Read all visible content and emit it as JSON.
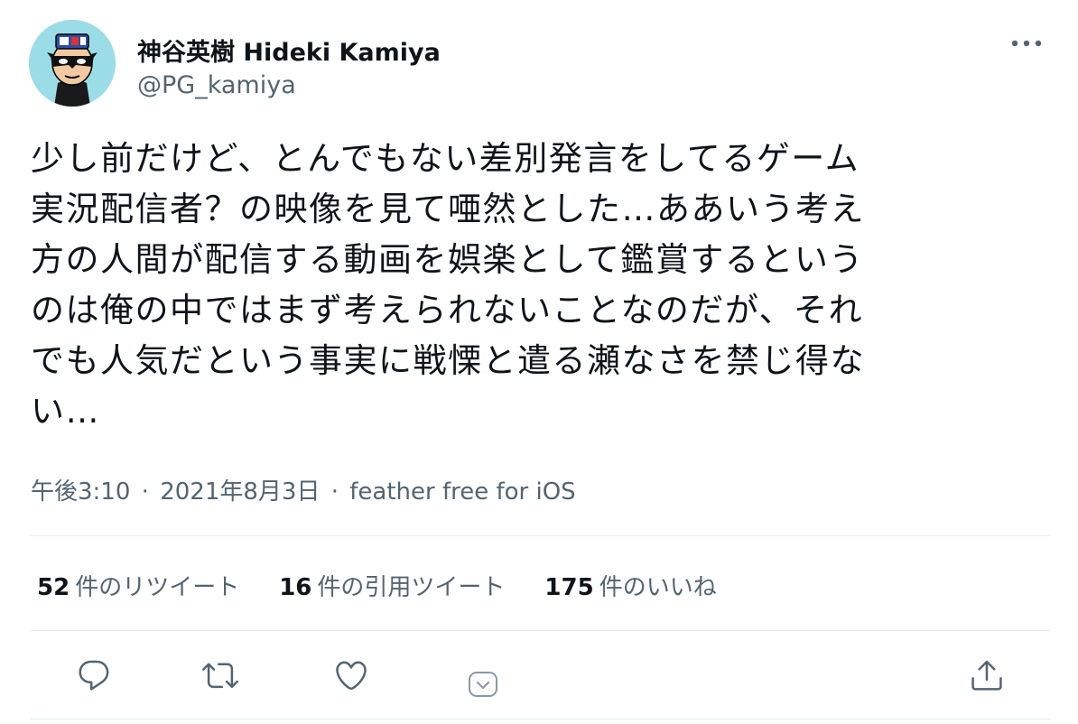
{
  "user": {
    "display_name": "神谷英樹 Hideki Kamiya",
    "handle": "@PG_kamiya",
    "avatar_bg": "#9bdde6"
  },
  "tweet": {
    "lines": [
      "少し前だけど、とんでもない差別発言をしてるゲーム",
      "実況配信者？の映像を見て唖然とした…ああいう考え",
      "方の人間が配信する動画を娯楽として鑑賞するという",
      "のは俺の中ではまず考えられないことなのだが、それ",
      "でも人気だという事実に戦慄と遣る瀬なさを禁じ得な",
      "い…"
    ]
  },
  "meta": {
    "time": "午後3:10",
    "date": "2021年8月3日",
    "source": "feather free for iOS",
    "separator": "·"
  },
  "stats": {
    "retweets_count": "52",
    "retweets_label": "件のリツイート",
    "quotes_count": "16",
    "quotes_label": "件の引用ツイート",
    "likes_count": "175",
    "likes_label": "件のいいね"
  },
  "actions": {
    "icons": [
      "reply-icon",
      "retweet-icon",
      "like-icon",
      "dropdown-icon",
      "share-icon"
    ],
    "icon_color": "#536471"
  },
  "colors": {
    "text_primary": "#0f1419",
    "text_secondary": "#536471",
    "divider": "#e6ecf0"
  }
}
